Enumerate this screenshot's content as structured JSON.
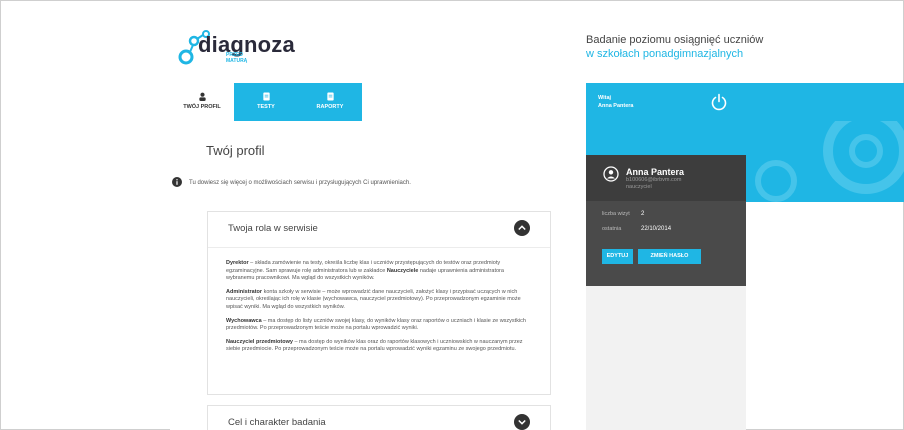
{
  "brand": {
    "name": "diagnoza",
    "sub_line1": "PRZED",
    "sub_line2": "MATURĄ"
  },
  "tagline": {
    "line1": "Badanie poziomu osiągnięć uczniów",
    "line2": "w szkołach ponadgimnazjalnych"
  },
  "tabs": [
    {
      "label": "TWÓJ PROFIL",
      "icon": "user-icon",
      "active": true
    },
    {
      "label": "TESTY",
      "icon": "document-icon",
      "active": false
    },
    {
      "label": "RAPORTY",
      "icon": "document-icon",
      "active": false
    }
  ],
  "header_user": {
    "greeting": "Witaj",
    "name": "Anna Pantera",
    "logout_icon": "power-icon"
  },
  "profile_card": {
    "name": "Anna Pantera",
    "email": "b100606@ibrbvm.com",
    "role": "nauczyciel",
    "visits_label": "liczba wizyt",
    "visits_value": "2",
    "last_label": "ostatnia",
    "last_value": "22/10/2014",
    "edit_button": "EDYTUJ",
    "password_button": "ZMIEŃ HASŁO"
  },
  "main": {
    "page_title": "Twój profil",
    "info_text": "Tu dowiesz się więcej o możliwościach serwisu i przysługujących Ci uprawnieniach.",
    "panels": [
      {
        "title": "Twoja rola w serwisie",
        "expanded": true,
        "roles": [
          {
            "name": "Dyrektor",
            "text": " – składa zamówienie na testy, określa liczbę klas i uczniów przystępujących do testów oraz przedmioty egzaminacyjne. Sam sprawuje rolę administratora lub w zakładce ",
            "bold2": "Nauczyciele",
            "text2": " nadaje uprawnienia administratora wybranemu pracownikowi. Ma wgląd do wszystkich wyników."
          },
          {
            "name": "Administrator",
            "text": " konta szkoły w serwisie – może wprowadzić dane nauczycieli, założyć klasy i przypisać uczących w nich nauczycieli, określając ich rolę w klasie (wychowawca, nauczyciel przedmiotowy). Po przeprowadzonym egzaminie może wpisać wyniki. Ma wgląd do wszystkich wyników."
          },
          {
            "name": "Wychowawca",
            "text": " – ma dostęp do listy uczniów swojej klasy, do wyników klasy oraz raportów o uczniach i klasie ze wszystkich przedmiotów. Po przeprowadzonym teście może na portalu wprowadzić wyniki."
          },
          {
            "name": "Nauczyciel przedmiotowy",
            "text": " – ma dostęp do wyników klas oraz do raportów klasowych i uczniowskich w nauczanym przez siebie przedmiocie. Po przeprowadzonym teście może na portalu wprowadzić wyniki egzaminu ze swojego przedmiotu."
          }
        ]
      },
      {
        "title": "Cel i charakter badania",
        "expanded": false
      }
    ]
  },
  "colors": {
    "accent": "#1fb6e4",
    "card_bg": "#4a4a4a",
    "page_grey": "#f2f2f2"
  }
}
